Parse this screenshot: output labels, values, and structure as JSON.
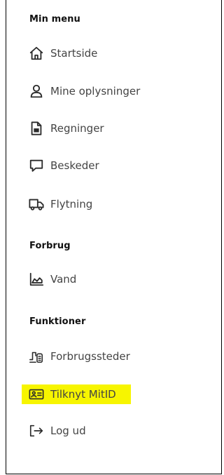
{
  "menu": {
    "title": "Min menu",
    "items": [
      {
        "label": "Startside",
        "icon": "home-icon"
      },
      {
        "label": "Mine oplysninger",
        "icon": "user-icon"
      },
      {
        "label": "Regninger",
        "icon": "document-icon"
      },
      {
        "label": "Beskeder",
        "icon": "message-icon"
      },
      {
        "label": "Flytning",
        "icon": "truck-icon"
      }
    ]
  },
  "consumption": {
    "title": "Forbrug",
    "items": [
      {
        "label": "Vand",
        "icon": "chart-icon"
      }
    ]
  },
  "functions": {
    "title": "Funktioner",
    "items": [
      {
        "label": "Forbrugssteder",
        "icon": "meter-icon"
      },
      {
        "label": "Tilknyt MitID",
        "icon": "id-card-icon",
        "highlighted": true
      },
      {
        "label": "Log ud",
        "icon": "logout-icon"
      }
    ]
  },
  "colors": {
    "highlight": "#f7f500",
    "icon": "#2b2b2b",
    "text": "#444444"
  }
}
